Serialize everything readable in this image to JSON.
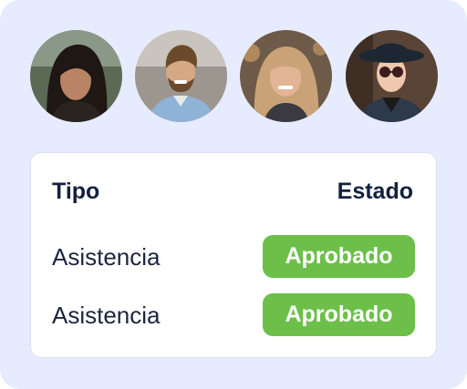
{
  "avatars": [
    {
      "icon": "person-photo-woman-dark-hair"
    },
    {
      "icon": "person-photo-man-beard"
    },
    {
      "icon": "person-photo-woman-blonde"
    },
    {
      "icon": "person-photo-person-hat-sunglasses"
    }
  ],
  "table": {
    "headers": {
      "type": "Tipo",
      "status": "Estado"
    },
    "rows": [
      {
        "type": "Asistencia",
        "status": "Aprobado"
      },
      {
        "type": "Asistencia",
        "status": "Aprobado"
      }
    ]
  },
  "colors": {
    "panel_background": "#e6ecfd",
    "approved_badge": "#6cc04a",
    "heading_text": "#14213d"
  }
}
